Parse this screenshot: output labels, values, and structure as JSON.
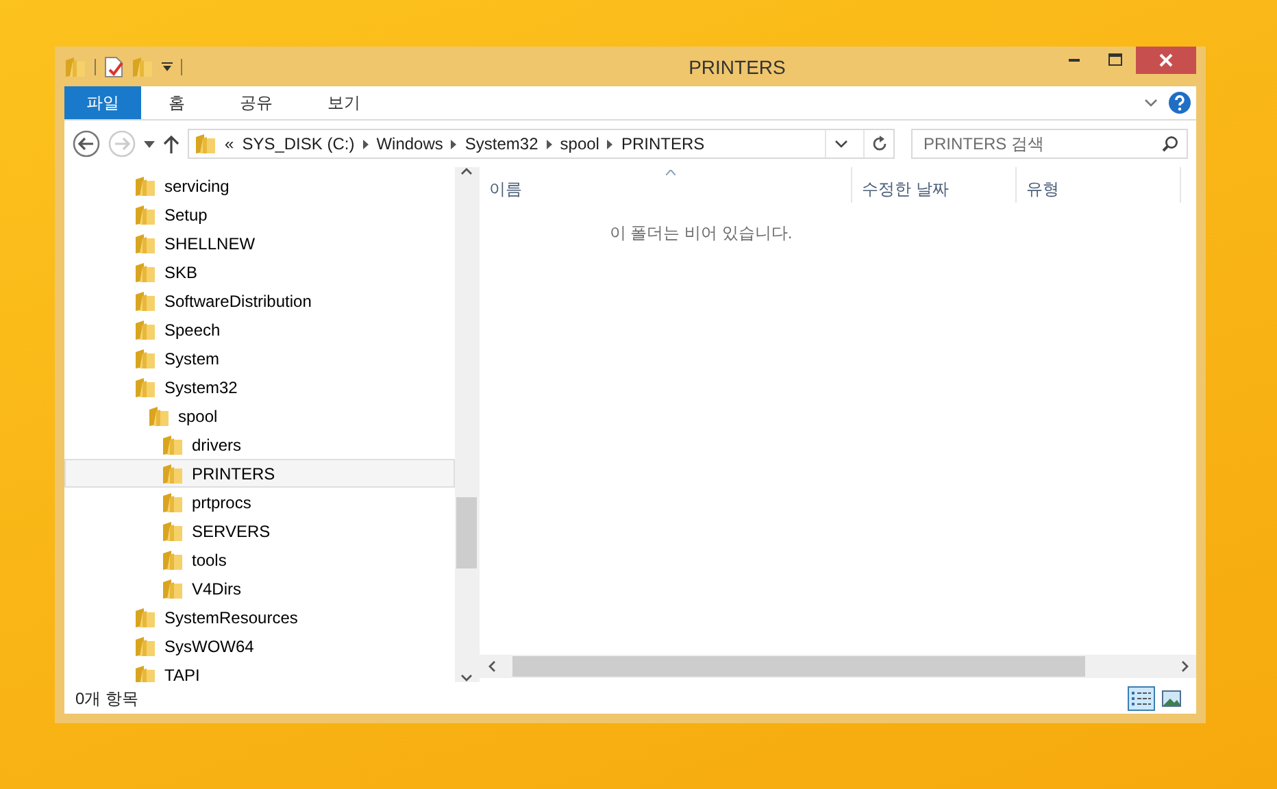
{
  "window": {
    "title": "PRINTERS"
  },
  "ribbon_tabs": [
    {
      "label": "파일",
      "selected": true
    },
    {
      "label": "홈",
      "selected": false
    },
    {
      "label": "공유",
      "selected": false
    },
    {
      "label": "보기",
      "selected": false
    }
  ],
  "address_bar": {
    "overflow": "«",
    "crumbs": [
      "SYS_DISK (C:)",
      "Windows",
      "System32",
      "spool",
      "PRINTERS"
    ]
  },
  "search": {
    "placeholder": "PRINTERS 검색"
  },
  "nav_back_disabled": false,
  "nav_forward_disabled": true,
  "tree": [
    {
      "name": "servicing",
      "selected": false
    },
    {
      "name": "Setup",
      "selected": false
    },
    {
      "name": "SHELLNEW",
      "selected": false
    },
    {
      "name": "SKB",
      "selected": false
    },
    {
      "name": "SoftwareDistribution",
      "selected": false
    },
    {
      "name": "Speech",
      "selected": false
    },
    {
      "name": "System",
      "selected": false
    },
    {
      "name": "System32",
      "selected": false,
      "children": [
        {
          "name": "spool",
          "selected": false,
          "children": [
            {
              "name": "drivers",
              "selected": false
            },
            {
              "name": "PRINTERS",
              "selected": true
            },
            {
              "name": "prtprocs",
              "selected": false
            },
            {
              "name": "SERVERS",
              "selected": false
            },
            {
              "name": "tools",
              "selected": false
            },
            {
              "name": "V4Dirs",
              "selected": false
            }
          ]
        }
      ]
    },
    {
      "name": "SystemResources",
      "selected": false
    },
    {
      "name": "SysWOW64",
      "selected": false
    },
    {
      "name": "TAPI",
      "selected": false
    }
  ],
  "columns": [
    {
      "label": "이름",
      "sorted": true
    },
    {
      "label": "수정한 날짜",
      "sorted": false
    },
    {
      "label": "유형",
      "sorted": false
    }
  ],
  "empty_message": "이 폴더는 비어 있습니다.",
  "status_bar": {
    "count": "0개 항목"
  },
  "view_buttons": [
    {
      "kind": "details",
      "selected": true
    },
    {
      "kind": "thumbnails",
      "selected": false
    }
  ]
}
